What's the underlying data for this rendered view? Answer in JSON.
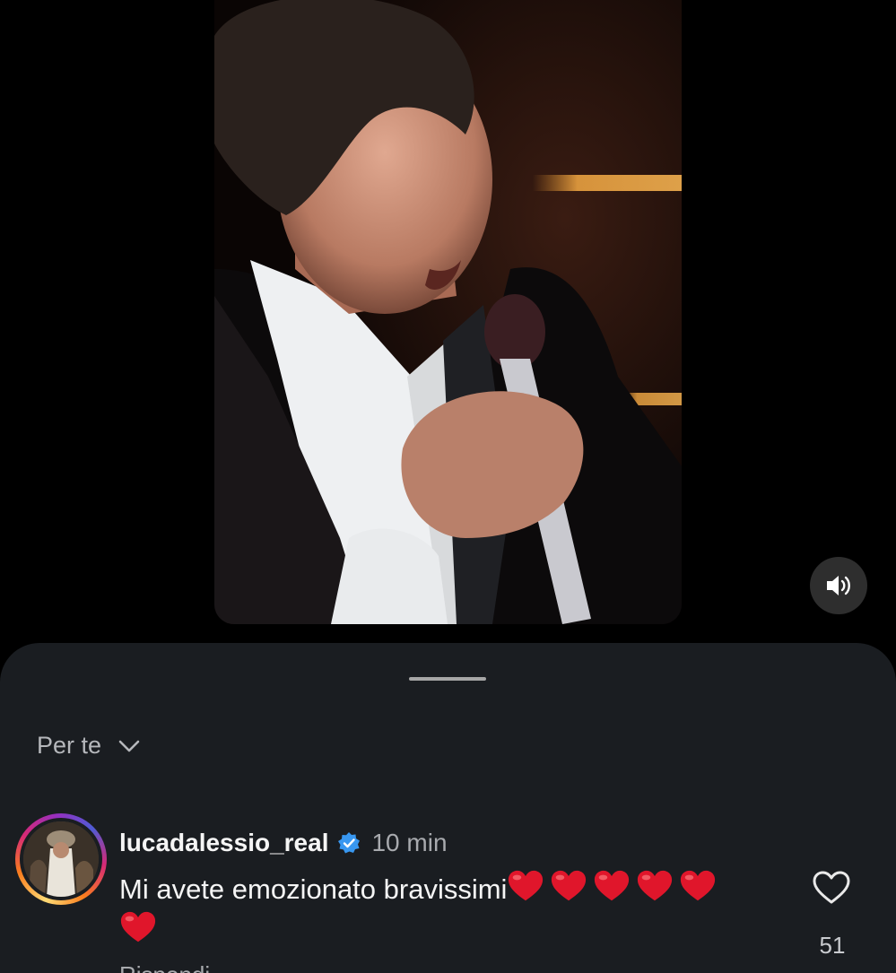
{
  "video": {
    "mute_icon": "speaker-on-icon"
  },
  "comments_sheet": {
    "filter_label": "Per te",
    "filter_icon": "chevron-down-icon"
  },
  "comment": {
    "username": "lucadalessio_real",
    "verified": true,
    "verified_color": "#3897f0",
    "time": "10 min",
    "text": "Mi avete emozionato bravissimi",
    "hearts_count": 6,
    "heart_color": "#e0162b",
    "reply_label": "Rispondi",
    "like_icon": "heart-outline-icon",
    "like_count": "51"
  }
}
